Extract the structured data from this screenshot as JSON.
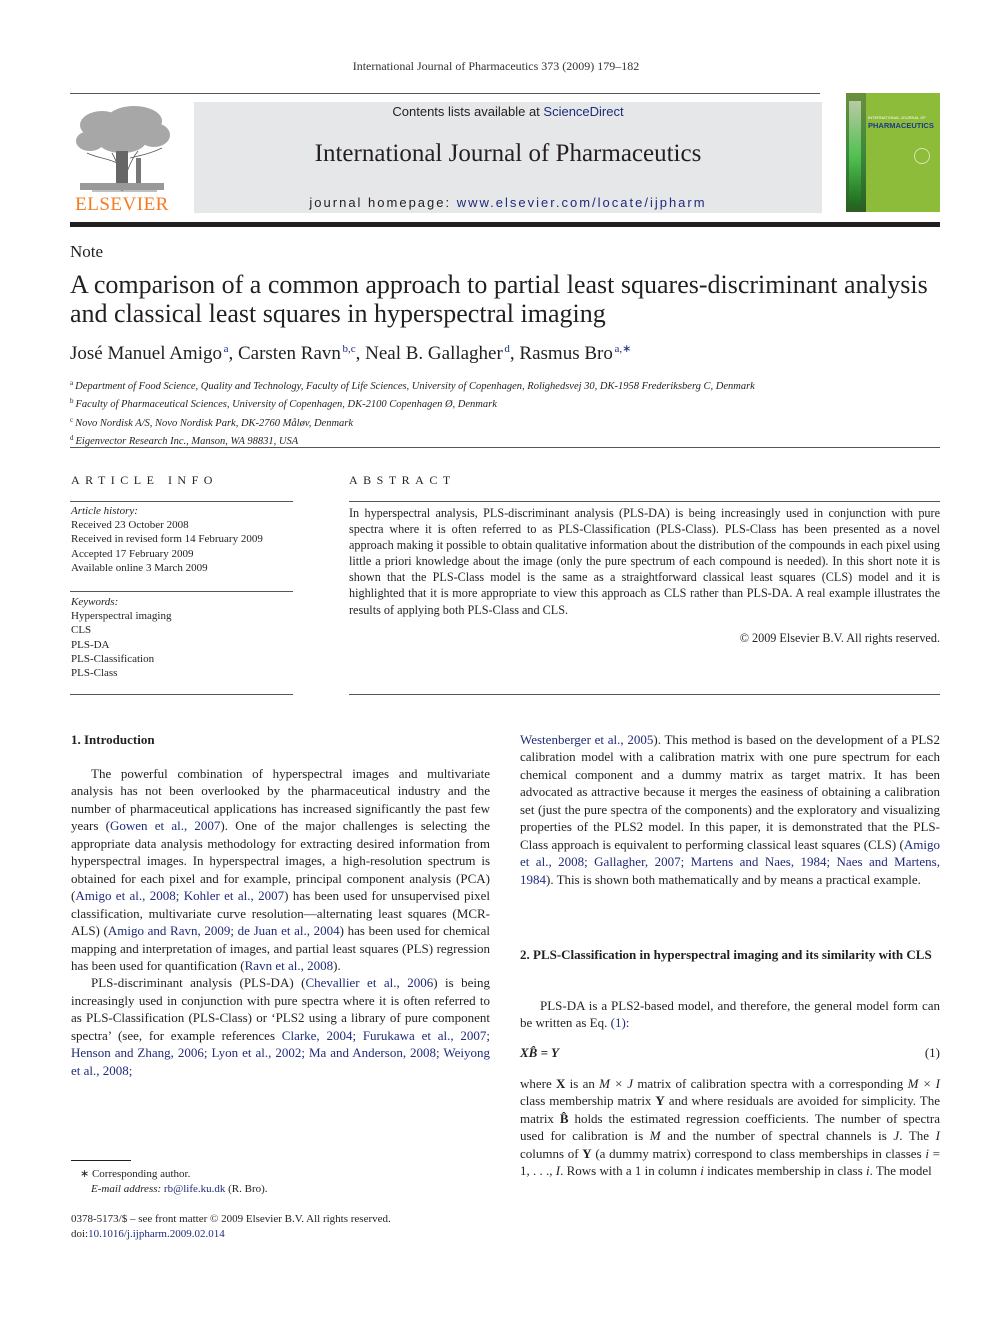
{
  "running_head": "International Journal of Pharmaceutics 373 (2009) 179–182",
  "publisher": {
    "logo_text": "ELSEVIER",
    "logo_color": "#f47b20"
  },
  "banner": {
    "contents_prefix": "Contents lists available at ",
    "contents_link": "ScienceDirect",
    "journal_title": "International Journal of Pharmaceutics",
    "homepage_prefix": "journal homepage: ",
    "homepage_link": "www.elsevier.com/locate/ijpharm",
    "background": "#e6e7e8",
    "link_color": "#1f2b7b"
  },
  "cover": {
    "label": "INTERNATIONAL JOURNAL OF",
    "brand": "PHARMACEUTICS",
    "color": "#8dbb3a"
  },
  "article": {
    "type": "Note",
    "title": "A comparison of a common approach to partial least squares-discriminant analysis and classical least squares in hyperspectral imaging",
    "authors": [
      {
        "name": "José Manuel Amigo",
        "affil": "a"
      },
      {
        "name": "Carsten Ravn",
        "affil": "b,c"
      },
      {
        "name": "Neal B. Gallagher",
        "affil": "d"
      },
      {
        "name": "Rasmus Bro",
        "affil": "a,∗"
      }
    ],
    "affiliations": [
      {
        "key": "a",
        "text": "Department of Food Science, Quality and Technology, Faculty of Life Sciences, University of Copenhagen, Rolighedsvej 30, DK-1958 Frederiksberg C, Denmark"
      },
      {
        "key": "b",
        "text": "Faculty of Pharmaceutical Sciences, University of Copenhagen, DK-2100 Copenhagen Ø, Denmark"
      },
      {
        "key": "c",
        "text": "Novo Nordisk A/S, Novo Nordisk Park, DK-2760 Måløv, Denmark"
      },
      {
        "key": "d",
        "text": "Eigenvector Research Inc., Manson, WA 98831, USA"
      }
    ]
  },
  "article_info": {
    "heading": "ARTICLE INFO",
    "history_label": "Article history:",
    "history": [
      "Received 23 October 2008",
      "Received in revised form 14 February 2009",
      "Accepted 17 February 2009",
      "Available online 3 March 2009"
    ],
    "keywords_label": "Keywords:",
    "keywords": [
      "Hyperspectral imaging",
      "CLS",
      "PLS-DA",
      "PLS-Classification",
      "PLS-Class"
    ]
  },
  "abstract": {
    "heading": "ABSTRACT",
    "text": "In hyperspectral analysis, PLS-discriminant analysis (PLS-DA) is being increasingly used in conjunction with pure spectra where it is often referred to as PLS-Classification (PLS-Class). PLS-Class has been presented as a novel approach making it possible to obtain qualitative information about the distribution of the compounds in each pixel using little a priori knowledge about the image (only the pure spectrum of each compound is needed). In this short note it is shown that the PLS-Class model is the same as a straightforward classical least squares (CLS) model and it is highlighted that it is more appropriate to view this approach as CLS rather than PLS-DA. A real example illustrates the results of applying both PLS-Class and CLS.",
    "copyright": "© 2009 Elsevier B.V. All rights reserved."
  },
  "body": {
    "section1": {
      "heading": "1.  Introduction",
      "p1": [
        {
          "t": "The powerful combination of hyperspectral images and multivariate analysis has not been overlooked by the pharmaceutical industry and the number of pharmaceutical applications has increased significantly the past few years ("
        },
        {
          "l": "Gowen et al., 2007"
        },
        {
          "t": "). One of the major challenges is selecting the appropriate data analysis methodology for extracting desired information from hyperspectral images. In hyperspectral images, a high-resolution spectrum is obtained for each pixel and for example, principal component analysis (PCA) ("
        },
        {
          "l": "Amigo et al., 2008; Kohler et al., 2007"
        },
        {
          "t": ") has been used for unsupervised pixel classification, multivariate curve resolution—alternating least squares (MCR-ALS) ("
        },
        {
          "l": "Amigo and Ravn, 2009; de Juan et al., 2004"
        },
        {
          "t": ") has been used for chemical mapping and interpretation of images, and partial least squares (PLS) regression has been used for quantification ("
        },
        {
          "l": "Ravn et al., 2008"
        },
        {
          "t": ")."
        }
      ],
      "p2": [
        {
          "t": "PLS-discriminant analysis (PLS-DA) ("
        },
        {
          "l": "Chevallier et al., 2006"
        },
        {
          "t": ") is being increasingly used in conjunction with pure spectra where it is often referred to as PLS-Classification (PLS-Class) or ‘PLS2 using a library of pure component spectra’ (see, for example references "
        },
        {
          "l": "Clarke, 2004; Furukawa et al., 2007; Henson and Zhang, 2006; Lyon et al., 2002; Ma and Anderson, 2008; Weiyong et al., 2008;"
        }
      ],
      "p3": [
        {
          "l": "Westenberger et al., 2005"
        },
        {
          "t": "). This method is based on the development of a PLS2 calibration model with a calibration matrix with one pure spectrum for each chemical component and a dummy matrix as target matrix. It has been advocated as attractive because it merges the easiness of obtaining a calibration set (just the pure spectra of the components) and the exploratory and visualizing properties of the PLS2 model. In this paper, it is demonstrated that the PLS-Class approach is equivalent to performing classical least squares (CLS) ("
        },
        {
          "l": "Amigo et al., 2008; Gallagher, 2007; Martens and Naes, 1984; Naes and Martens, 1984"
        },
        {
          "t": "). This is shown both mathematically and by means a practical example."
        }
      ]
    },
    "section2": {
      "heading": "2.  PLS-Classification in hyperspectral imaging and its similarity with CLS",
      "p1": [
        {
          "t": "PLS-DA is a PLS2-based model, and therefore, the general model form can be written as Eq. "
        },
        {
          "l": "(1)"
        },
        {
          "t": ":"
        }
      ],
      "equation": {
        "lhs": "XB̂ = Y",
        "number": "(1)"
      },
      "p2": [
        {
          "t": "where "
        },
        {
          "b": "X"
        },
        {
          "t": " is an "
        },
        {
          "i": "M × J"
        },
        {
          "t": " matrix of calibration spectra with a corresponding "
        },
        {
          "i": "M × I"
        },
        {
          "t": " class membership matrix "
        },
        {
          "b": "Y"
        },
        {
          "t": " and where residuals are avoided for simplicity. The matrix "
        },
        {
          "b": "B̂"
        },
        {
          "t": " holds the estimated regression coefficients. The number of spectra used for calibration is "
        },
        {
          "i": "M"
        },
        {
          "t": " and the number of spectral channels is "
        },
        {
          "i": "J"
        },
        {
          "t": ". The "
        },
        {
          "i": "I"
        },
        {
          "t": " columns of "
        },
        {
          "b": "Y"
        },
        {
          "t": " (a dummy matrix) correspond to class memberships in classes "
        },
        {
          "i": "i"
        },
        {
          "t": " = 1, . . ., "
        },
        {
          "i": "I"
        },
        {
          "t": ". Rows with a 1 in column "
        },
        {
          "i": "i"
        },
        {
          "t": " indicates membership in class "
        },
        {
          "i": "i"
        },
        {
          "t": ". The model"
        }
      ]
    }
  },
  "footnotes": {
    "corresponding": "∗   Corresponding author.",
    "email_label": "E-mail address: ",
    "email": "rb@life.ku.dk",
    "email_suffix": " (R. Bro).",
    "issn": "0378-5173/$ – see front matter © 2009 Elsevier B.V. All rights reserved.",
    "doi_prefix": "doi:",
    "doi": "10.1016/j.ijpharm.2009.02.014"
  }
}
